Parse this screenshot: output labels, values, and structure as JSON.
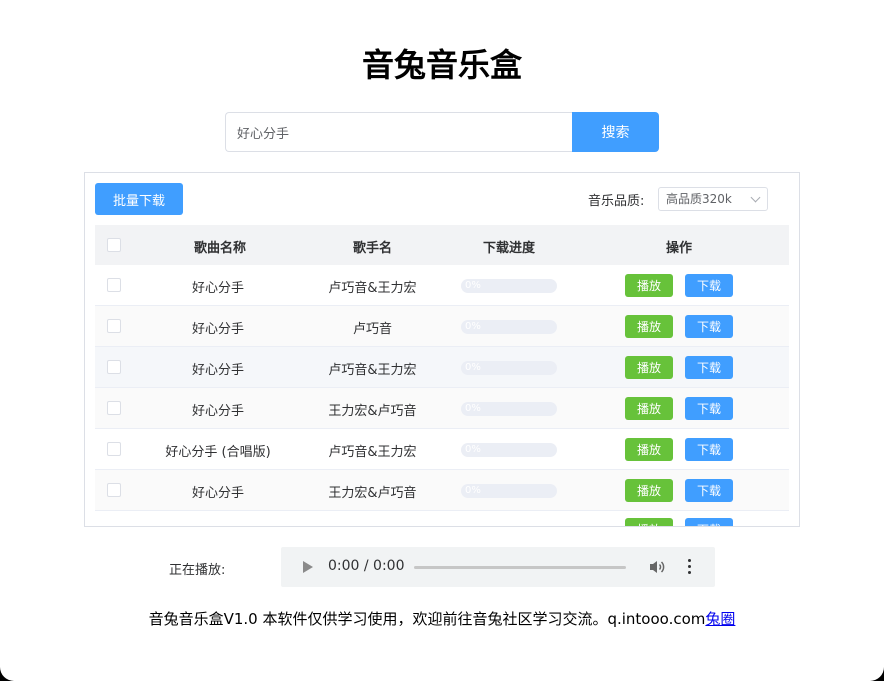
{
  "app": {
    "title": "音兔音乐盒"
  },
  "search": {
    "value": "好心分手",
    "button_label": "搜索"
  },
  "toolbar": {
    "batch_download_label": "批量下载",
    "quality_label": "音乐品质:",
    "quality_selected": "高品质320k"
  },
  "table": {
    "columns": [
      "歌曲名称",
      "歌手名",
      "下载进度",
      "操作"
    ],
    "rows": [
      {
        "song": "好心分手",
        "artist": "卢巧音&王力宏",
        "progress": "0%",
        "play": "播放",
        "download": "下载"
      },
      {
        "song": "好心分手",
        "artist": "卢巧音",
        "progress": "0%",
        "play": "播放",
        "download": "下载"
      },
      {
        "song": "好心分手",
        "artist": "卢巧音&王力宏",
        "progress": "0%",
        "play": "播放",
        "download": "下载"
      },
      {
        "song": "好心分手",
        "artist": "王力宏&卢巧音",
        "progress": "0%",
        "play": "播放",
        "download": "下载"
      },
      {
        "song": "好心分手 (合唱版)",
        "artist": "卢巧音&王力宏",
        "progress": "0%",
        "play": "播放",
        "download": "下载"
      },
      {
        "song": "好心分手",
        "artist": "王力宏&卢巧音",
        "progress": "0%",
        "play": "播放",
        "download": "下载"
      },
      {
        "song": "",
        "artist": "",
        "progress": "",
        "play": "播放",
        "download": "下载"
      }
    ]
  },
  "player": {
    "now_playing_label": "正在播放:",
    "time": "0:00 / 0:00"
  },
  "footer": {
    "text": "音兔音乐盒V1.0 本软件仅供学习使用，欢迎前往音兔社区学习交流。q.intooo.com",
    "link_label": "兔圈"
  },
  "colors": {
    "primary": "#409eff",
    "success": "#67c23a"
  }
}
